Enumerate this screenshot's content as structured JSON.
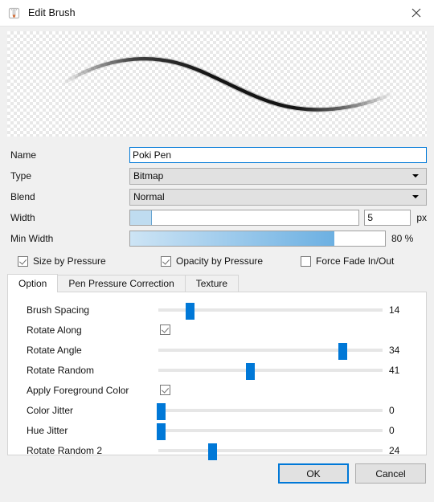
{
  "titlebar": {
    "title": "Edit Brush",
    "icon": "brush-icon",
    "close_label": "Close"
  },
  "preview": {
    "name": "brush-stroke-preview",
    "stroke_color": "#141414"
  },
  "form": {
    "name": {
      "label": "Name",
      "value": "Poki Pen",
      "placeholder": ""
    },
    "type": {
      "label": "Type",
      "value": "Bitmap",
      "options": [
        "Bitmap"
      ]
    },
    "blend": {
      "label": "Blend",
      "value": "Normal",
      "options": [
        "Normal"
      ]
    },
    "width": {
      "label": "Width",
      "value": "5",
      "unit": "px",
      "fill_percent": 9
    },
    "min_width": {
      "label": "Min Width",
      "value": "80 %",
      "fill_percent": 80
    }
  },
  "pressure_checks": [
    {
      "label": "Size by Pressure",
      "checked": true
    },
    {
      "label": "Opacity by Pressure",
      "checked": true
    },
    {
      "label": "Force Fade In/Out",
      "checked": false
    }
  ],
  "tabs": [
    {
      "label": "Option",
      "active": true
    },
    {
      "label": "Pen Pressure Correction",
      "active": false
    },
    {
      "label": "Texture",
      "active": false
    }
  ],
  "options": [
    {
      "label": "Brush Spacing",
      "kind": "slider",
      "value": "14",
      "thumb_percent": 14
    },
    {
      "label": "Rotate Along",
      "kind": "checkbox",
      "checked": true
    },
    {
      "label": "Rotate Angle",
      "kind": "slider",
      "value": "34",
      "thumb_percent": 82
    },
    {
      "label": "Rotate Random",
      "kind": "slider",
      "value": "41",
      "thumb_percent": 41
    },
    {
      "label": "Apply Foreground Color",
      "kind": "checkbox",
      "checked": true
    },
    {
      "label": "Color Jitter",
      "kind": "slider",
      "value": "0",
      "thumb_percent": 1
    },
    {
      "label": "Hue Jitter",
      "kind": "slider",
      "value": "0",
      "thumb_percent": 1
    },
    {
      "label": "Rotate Random 2",
      "kind": "slider",
      "value": "24",
      "thumb_percent": 24
    }
  ],
  "footer": {
    "ok_label": "OK",
    "cancel_label": "Cancel"
  },
  "colors": {
    "accent": "#0078d7",
    "slider_track": "#e6e6e6",
    "window_bg": "#f0f0f0",
    "panel_bg": "#ffffff",
    "fill_light": "#bfdcf0"
  }
}
